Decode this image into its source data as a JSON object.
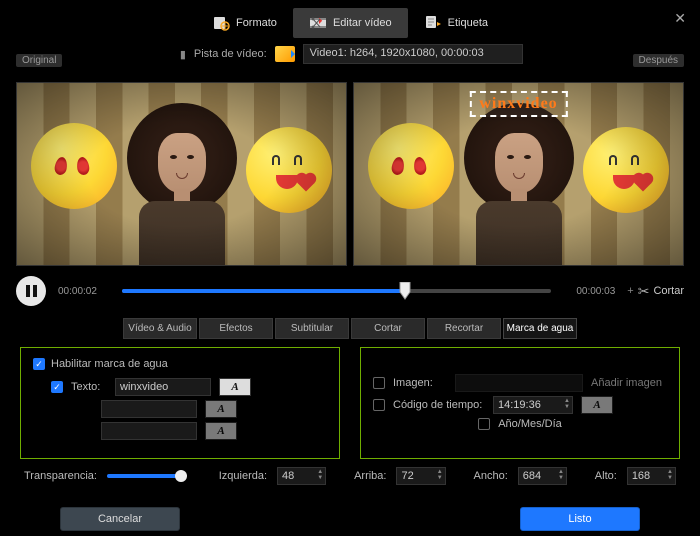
{
  "top_tabs": {
    "format": "Formato",
    "edit": "Editar vídeo",
    "tag": "Etiqueta"
  },
  "close_glyph": "✕",
  "track": {
    "label": "Pista de vídeo:",
    "value": "Video1: h264, 1920x1080, 00:00:03"
  },
  "preview": {
    "left_label": "Original",
    "right_label": "Después",
    "watermark_text": "winxvideo"
  },
  "playback": {
    "current": "00:00:02",
    "total": "00:00:03",
    "cut_label": "Cortar"
  },
  "edit_tabs": {
    "va": "Vídeo & Audio",
    "fx": "Efectos",
    "sub": "Subtitular",
    "cut": "Cortar",
    "crop": "Recortar",
    "wm": "Marca de agua"
  },
  "wm_panel": {
    "enable": "Habilitar marca de agua",
    "text_label": "Texto:",
    "text_value": "winxvideo",
    "font_glyph": "A",
    "image_label": "Imagen:",
    "image_hint": "Añadir imagen",
    "timecode_label": "Código de tiempo:",
    "timecode_value": "14:19:36",
    "ymd_label": "Año/Mes/Día"
  },
  "pos": {
    "trans_label": "Transparencia:",
    "left_label": "Izquierda:",
    "left_val": "48",
    "top_label": "Arriba:",
    "top_val": "72",
    "w_label": "Ancho:",
    "w_val": "684",
    "h_label": "Alto:",
    "h_val": "168"
  },
  "footer": {
    "cancel": "Cancelar",
    "done": "Listo"
  }
}
